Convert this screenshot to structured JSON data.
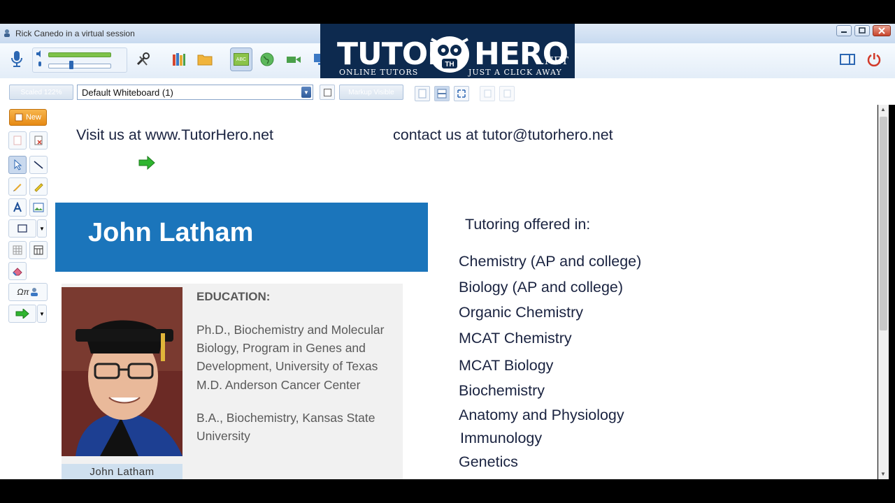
{
  "window": {
    "title": "Rick Canedo in a virtual session",
    "controls": [
      "minimize",
      "maximize",
      "close"
    ]
  },
  "toolbar": {
    "buttons": [
      "microphone-icon",
      "speaker-icon",
      "tools-icon",
      "library-icon",
      "folder-icon",
      "whiteboard-icon",
      "web-browser-icon",
      "video-icon",
      "screen-share-icon",
      "layout-icon",
      "power-icon"
    ],
    "whiteboard_badge": "ABC"
  },
  "subbar": {
    "zoom_label": "Scaled 122%",
    "whiteboard_select": "Default Whiteboard (1)",
    "markup_button": "Markup Visible"
  },
  "tools": {
    "new_label": "New",
    "symbols_label": "Ωπ"
  },
  "logo": {
    "word_left": "TUTOR",
    "word_right": "HERO",
    "suffix": ".NET",
    "mark": "TH",
    "tagline_left": "ONLINE TUTORS",
    "tagline_right": "JUST A CLICK AWAY"
  },
  "canvas": {
    "visit": "Visit us at www.TutorHero.net",
    "contact": "contact us at tutor@tutorhero.net",
    "banner_name": "John Latham",
    "education_heading": "EDUCATION:",
    "education_1": [
      "Ph.D., Biochemistry and Molecular",
      "Biology, Program in Genes and",
      "Development, University of Texas",
      "M.D. Anderson Cancer Center"
    ],
    "education_2": [
      "B.A., Biochemistry, Kansas State",
      "University"
    ],
    "photo_caption": "John Latham",
    "tutoring_heading": "Tutoring offered in:",
    "subjects": [
      "Chemistry (AP and college)",
      "Biology (AP and college)",
      "Organic Chemistry",
      "MCAT Chemistry",
      "MCAT Biology",
      "Biochemistry",
      "Anatomy and Physiology",
      "Immunology",
      "Genetics"
    ]
  },
  "colors": {
    "banner_blue": "#1b75bb",
    "text_navy": "#1a2340",
    "logo_navy": "#0d2a4f",
    "new_button_orange": "#f39c2a",
    "arrow_green": "#2fb52f"
  }
}
